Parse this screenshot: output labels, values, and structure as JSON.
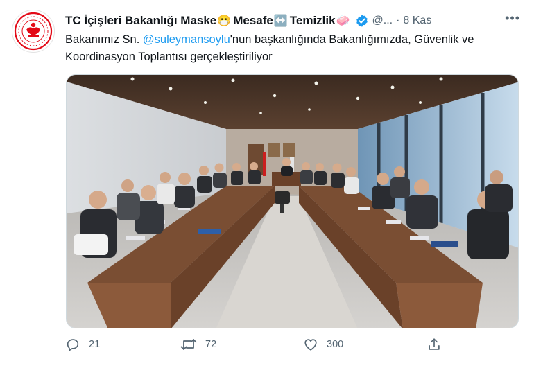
{
  "account": {
    "display_name": "TC İçişleri Bakanlığı Maske",
    "name_part2": "Mesafe",
    "name_part3": "Temizlik",
    "emoji_mask": "😷",
    "emoji_arrows": "↔️",
    "emoji_soap": "🧼",
    "handle": "@...",
    "separator": "·",
    "time": "8 Kas",
    "verified_color": "#1d9bf0"
  },
  "tweet": {
    "text_before": "Bakanımız Sn. ",
    "mention": "@suleymansoylu",
    "text_after": "'nun başkanlığında Bakanlığımızda, Güvenlik ve Koordinasyon Toplantısı gerçekleştiriliyor",
    "media_icon": "meeting-room-photo"
  },
  "actions": {
    "reply_count": "21",
    "retweet_count": "72",
    "like_count": "300",
    "reply_icon": "reply-icon",
    "retweet_icon": "retweet-icon",
    "like_icon": "heart-icon",
    "share_icon": "share-icon"
  },
  "more_label": "•••",
  "colors": {
    "accent": "#1d9bf0",
    "secondary_text": "#536471",
    "emblem_red": "#e30a17"
  }
}
